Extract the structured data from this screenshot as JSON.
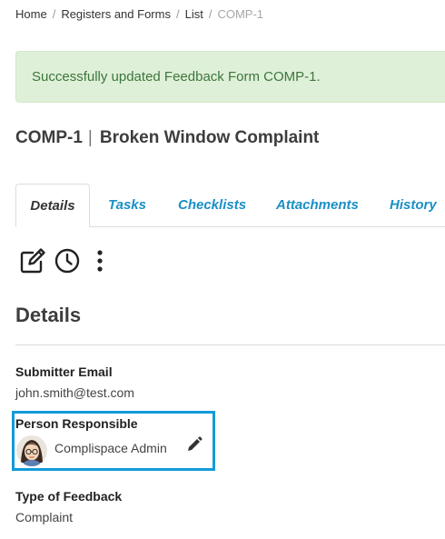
{
  "breadcrumb": {
    "items": [
      "Home",
      "Registers and Forms",
      "List"
    ],
    "current": "COMP-1",
    "separator": "/"
  },
  "alert": {
    "message": "Successfully updated Feedback Form COMP-1.",
    "color": "#3c763d",
    "background": "#dff0d8"
  },
  "record": {
    "id": "COMP-1",
    "separator": "|",
    "title": "Broken Window Complaint"
  },
  "tabs": [
    {
      "label": "Details",
      "active": true
    },
    {
      "label": "Tasks",
      "active": false
    },
    {
      "label": "Checklists",
      "active": false
    },
    {
      "label": "Attachments",
      "active": false
    },
    {
      "label": "History",
      "active": false
    }
  ],
  "toolbar": {
    "icons": [
      "edit-icon",
      "history-clock-icon",
      "more-vertical-icon"
    ]
  },
  "details": {
    "heading": "Details",
    "fields": {
      "submitter_email": {
        "label": "Submitter Email",
        "value": "john.smith@test.com"
      },
      "person_responsible": {
        "label": "Person Responsible",
        "value": "Complispace Admin"
      },
      "type_of_feedback": {
        "label": "Type of Feedback",
        "value": "Complaint"
      }
    }
  },
  "colors": {
    "link": "#1a8fc6",
    "highlight_box": "#139bd8"
  }
}
